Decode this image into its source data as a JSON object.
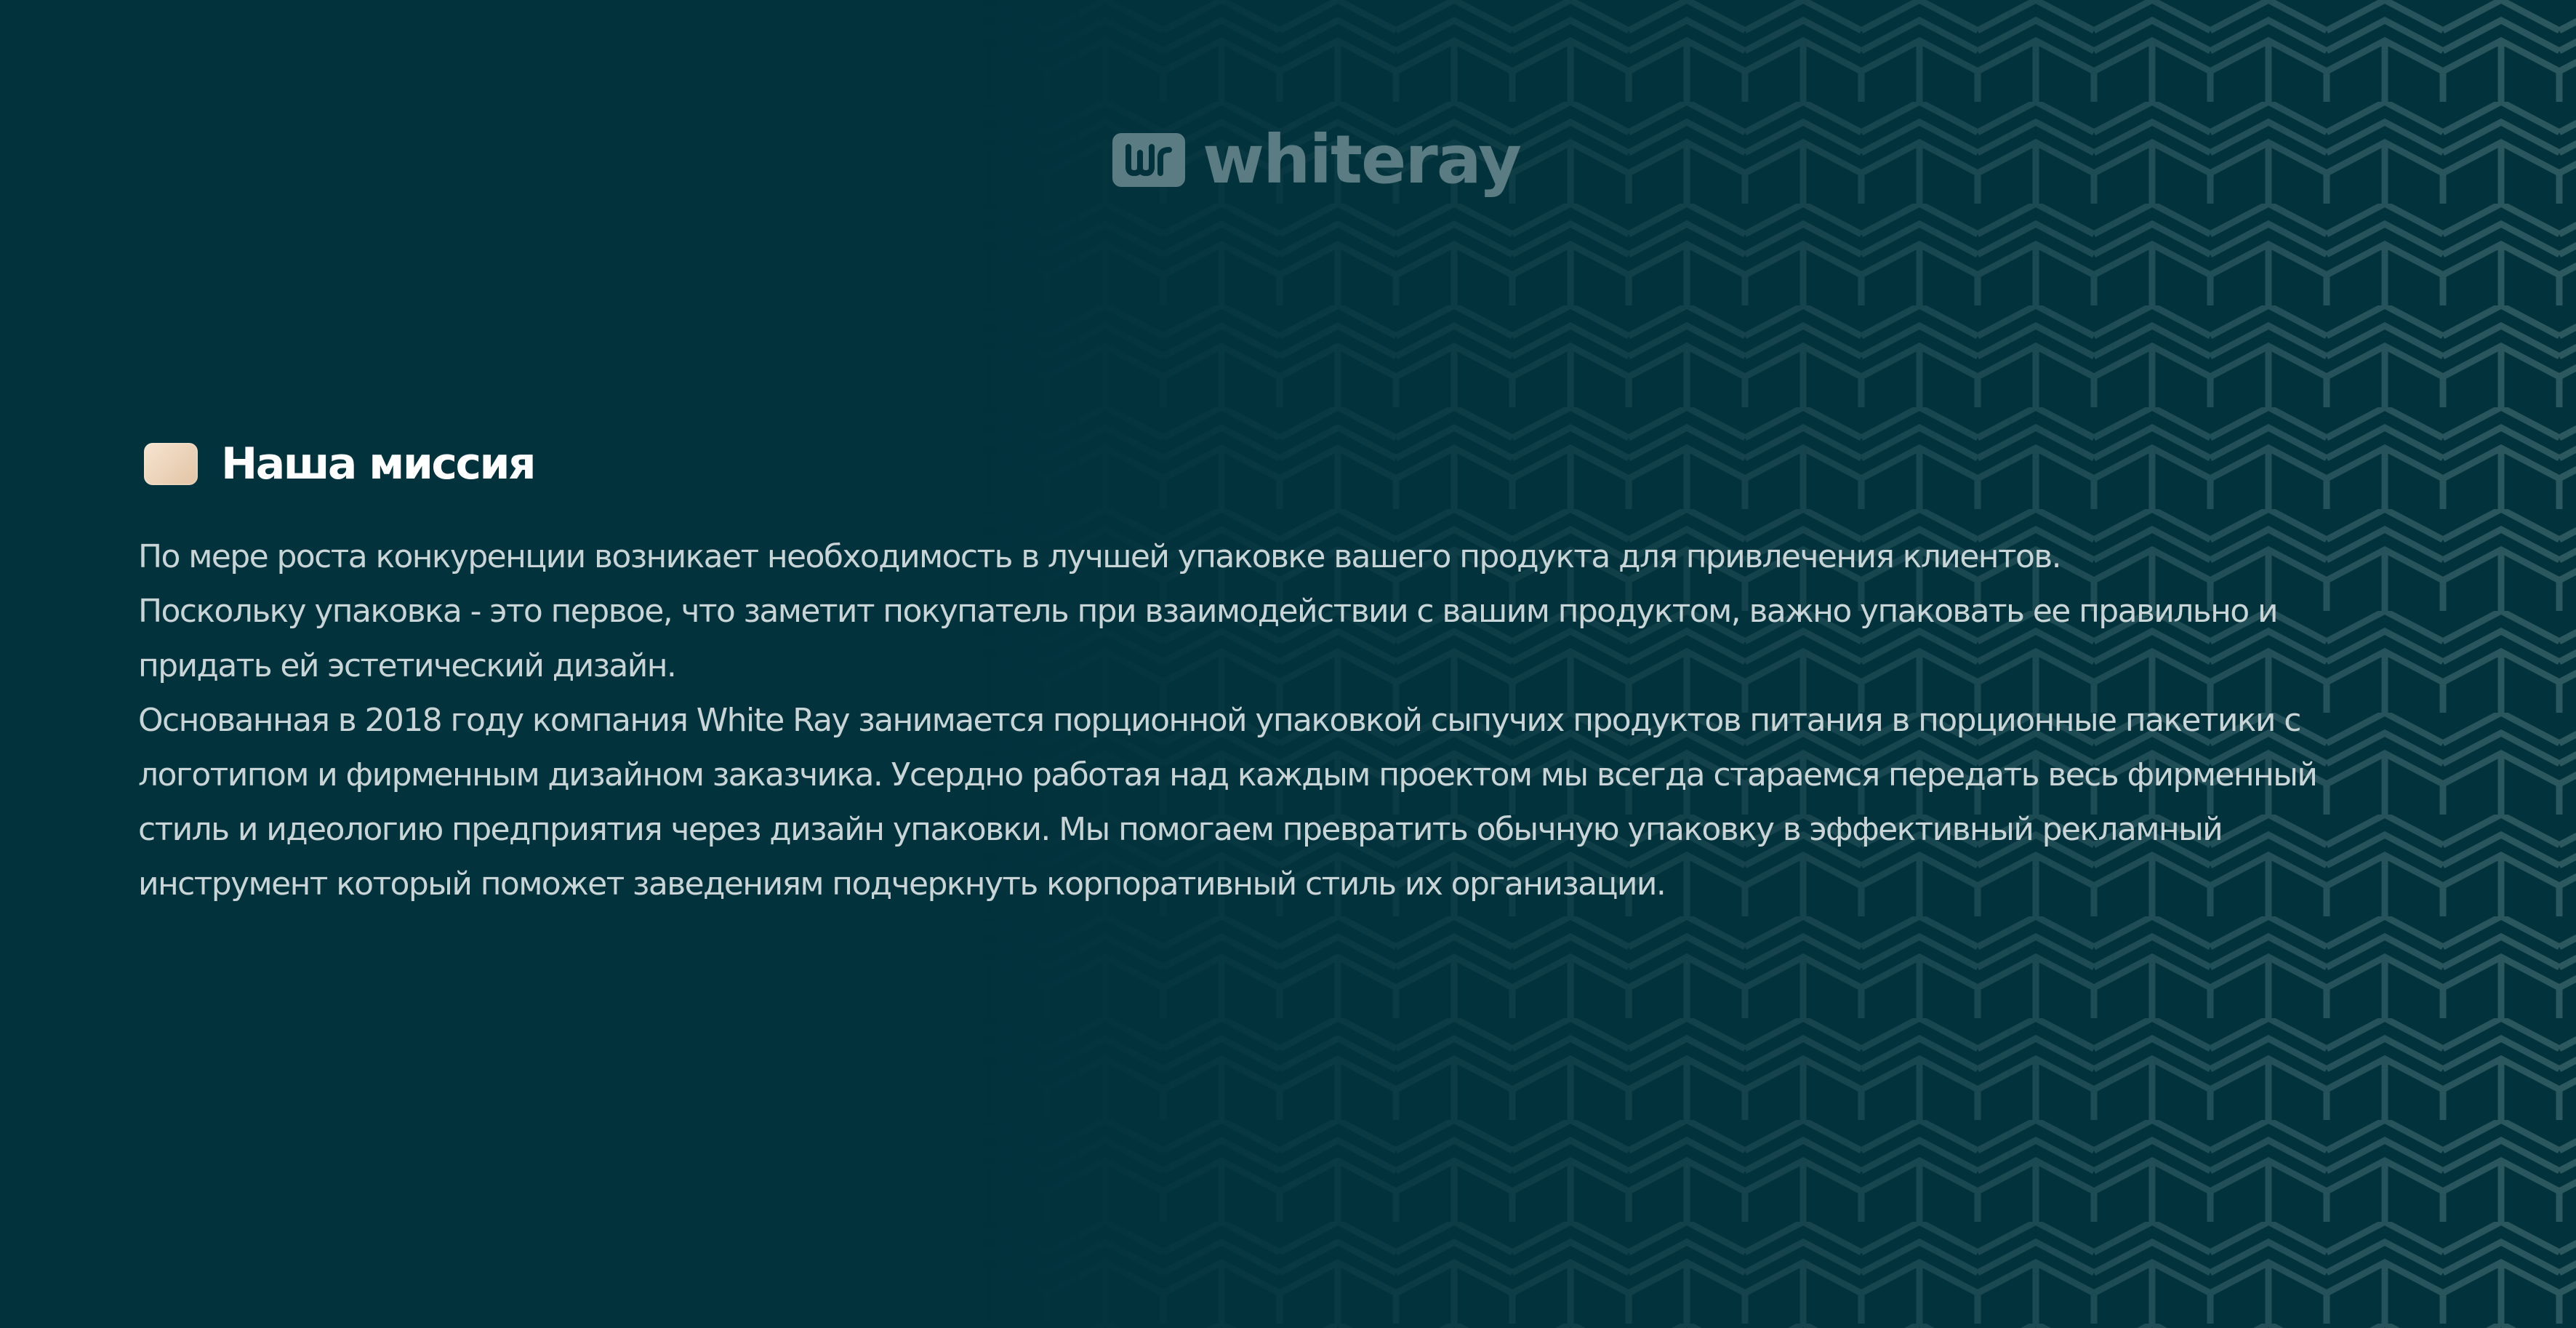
{
  "brand": {
    "logo_text": "whiteray",
    "logo_mark_icon": "whiteray-logo-mark-icon",
    "logo_color": "#5b7c82"
  },
  "colors": {
    "background": "#02323c",
    "pattern_stroke": "#2c5860",
    "heading_text": "#ffffff",
    "body_text": "#c9d4d6",
    "accent_swatch": "#eed6bc"
  },
  "section": {
    "title": "Наша миссия",
    "paragraphs": [
      "По мере роста конкуренции возникает необходимость в лучшей упаковке вашего продукта для привлечения клиентов.",
      "Поскольку упаковка - это первое, что заметит покупатель при взаимодействии с вашим продуктом, важно упаковать ее правильно и придать ей эстетический дизайн.",
      "Основанная в 2018 году компания  White Ray занимается порционной упаковкой сыпучих продуктов питания в порционные пакетики с логотипом и фирменным дизайном заказчика.  Усердно работая над каждым проектом мы всегда стараемся передать весь фирменный стиль и идеологию предприятия через дизайн упаковки. Мы помогаем превратить обычную упаковку в эффективный рекламный инструмент который поможет заведениям подчеркнуть корпоративный стиль их организации."
    ]
  }
}
